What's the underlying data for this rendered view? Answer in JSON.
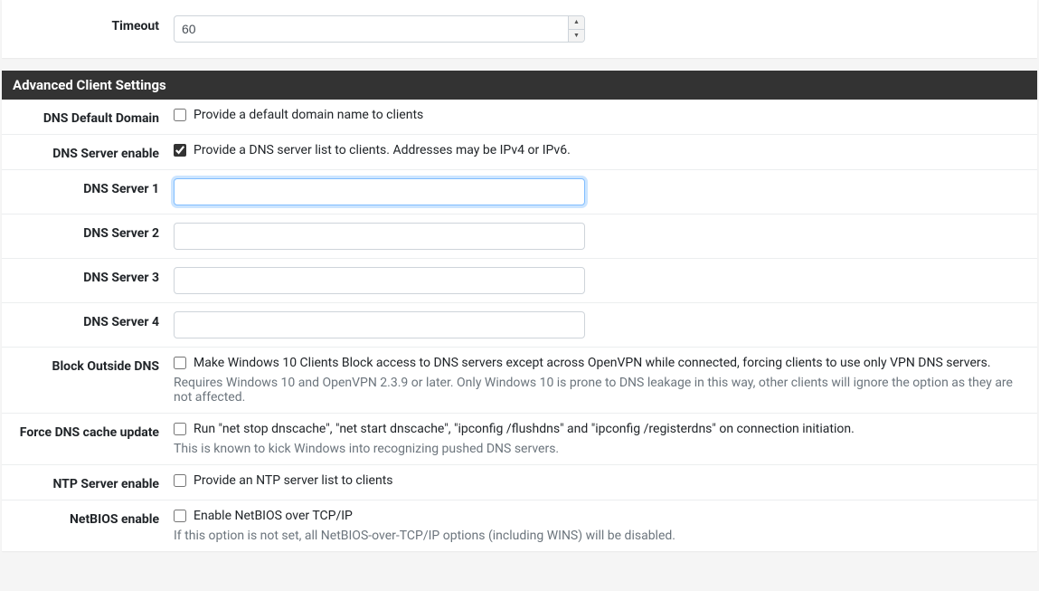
{
  "timeout": {
    "label": "Timeout",
    "value": "60"
  },
  "section_header": "Advanced Client Settings",
  "dns_default_domain": {
    "label": "DNS Default Domain",
    "checkbox_label": "Provide a default domain name to clients",
    "checked": false
  },
  "dns_server_enable": {
    "label": "DNS Server enable",
    "checkbox_label": "Provide a DNS server list to clients. Addresses may be IPv4 or IPv6.",
    "checked": true
  },
  "dns_server_1": {
    "label": "DNS Server 1",
    "value": ""
  },
  "dns_server_2": {
    "label": "DNS Server 2",
    "value": ""
  },
  "dns_server_3": {
    "label": "DNS Server 3",
    "value": ""
  },
  "dns_server_4": {
    "label": "DNS Server 4",
    "value": ""
  },
  "block_outside_dns": {
    "label": "Block Outside DNS",
    "checkbox_label": "Make Windows 10 Clients Block access to DNS servers except across OpenVPN while connected, forcing clients to use only VPN DNS servers.",
    "help": "Requires Windows 10 and OpenVPN 2.3.9 or later. Only Windows 10 is prone to DNS leakage in this way, other clients will ignore the option as they are not affected.",
    "checked": false
  },
  "force_dns_cache_update": {
    "label": "Force DNS cache update",
    "checkbox_label": "Run \"net stop dnscache\", \"net start dnscache\", \"ipconfig /flushdns\" and \"ipconfig /registerdns\" on connection initiation.",
    "help": "This is known to kick Windows into recognizing pushed DNS servers.",
    "checked": false
  },
  "ntp_server_enable": {
    "label": "NTP Server enable",
    "checkbox_label": "Provide an NTP server list to clients",
    "checked": false
  },
  "netbios_enable": {
    "label": "NetBIOS enable",
    "checkbox_label": "Enable NetBIOS over TCP/IP",
    "help": "If this option is not set, all NetBIOS-over-TCP/IP options (including WINS) will be disabled.",
    "checked": false
  }
}
